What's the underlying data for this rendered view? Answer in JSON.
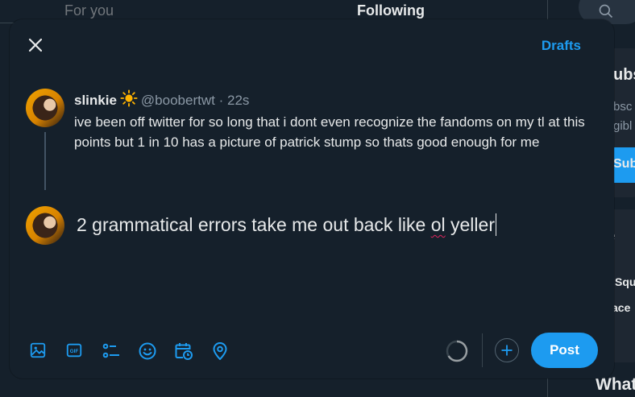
{
  "background": {
    "tabs": [
      "For you",
      "Following"
    ],
    "right_panel": {
      "subscribe_heading_fragment": "ubs",
      "subscribe_text_line1": "bsc",
      "subscribe_text_line2": "gibl",
      "subscribe_button_fragment": "Sub",
      "section_heading_fragment": "ve",
      "item1_fragment": "Squ",
      "item2_fragment": "ace",
      "bottom_heading_fragment": "What"
    }
  },
  "composer": {
    "drafts_label": "Drafts",
    "quoted_post": {
      "display_name": "slinkie",
      "handle": "@boobertwt",
      "separator": "·",
      "time": "22s",
      "text": "ive been off twitter for so long that i dont even recognize the fandoms on my tl at this points but 1 in 10 has a picture of patrick stump so thats good enough for me"
    },
    "reply": {
      "text_before": "2 grammatical errors take me out back like ",
      "misspelled_word": "ol",
      "text_after": " yeller"
    },
    "toolbar": {
      "icons": [
        "image-icon",
        "gif-icon",
        "poll-icon",
        "emoji-icon",
        "schedule-icon",
        "location-icon"
      ]
    },
    "post_label": "Post"
  },
  "colors": {
    "accent": "#1d9bf0",
    "background": "#15202b",
    "text": "#e7e9ea",
    "muted": "#8b98a5"
  }
}
